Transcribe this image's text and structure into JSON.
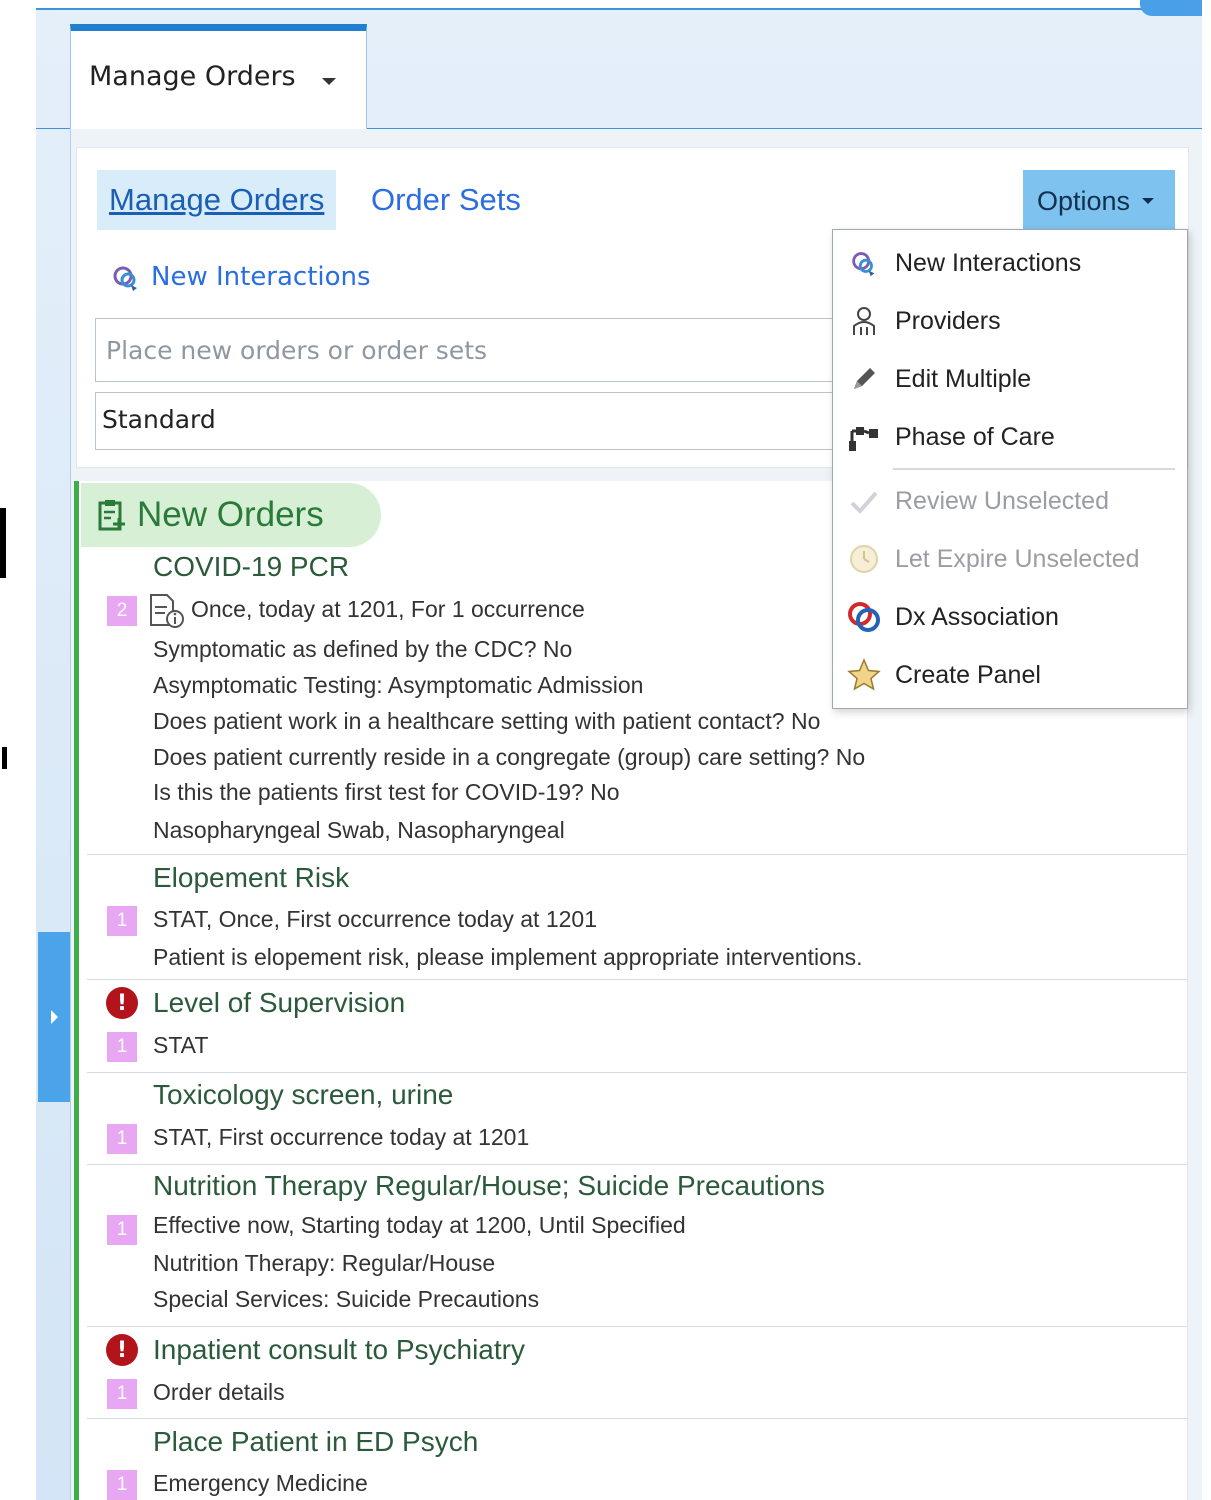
{
  "window": {
    "tab_title": "Manage Orders"
  },
  "nav": {
    "manage_orders": "Manage Orders",
    "order_sets": "Order Sets",
    "options": "Options"
  },
  "actions": {
    "new_interactions": "New Interactions"
  },
  "search": {
    "placeholder": "Place new orders or order sets",
    "value": ""
  },
  "mode": {
    "selected": "Standard"
  },
  "orders_section": {
    "title": "New Orders"
  },
  "orders": [
    {
      "name": "COVID-19 PCR",
      "badge": "2",
      "lines": [
        "Once, today at 1201, For 1 occurrence",
        "Symptomatic as defined by the CDC? No",
        "Asymptomatic Testing: Asymptomatic Admission",
        "Does patient work in a healthcare setting with patient contact? No",
        "Does patient currently reside in a congregate (group) care setting? No",
        "Is this the patients first test for COVID-19? No",
        "Nasopharyngeal Swab, Nasopharyngeal"
      ]
    },
    {
      "name": "Elopement Risk",
      "badge": "1",
      "lines": [
        "STAT,  Once, First occurrence today at 1201",
        "Patient is elopement risk, please implement appropriate interventions."
      ]
    },
    {
      "name": "Level of Supervision",
      "badge": "1",
      "alert": true,
      "lines": [
        "STAT"
      ]
    },
    {
      "name": "Toxicology screen, urine",
      "badge": "1",
      "lines": [
        "STAT, First occurrence today at 1201"
      ]
    },
    {
      "name": "Nutrition Therapy Regular/House; Suicide Precautions",
      "badge": "1",
      "lines": [
        "Effective now, Starting today at 1200, Until Specified",
        "Nutrition Therapy: Regular/House",
        "Special Services: Suicide Precautions"
      ]
    },
    {
      "name": "Inpatient consult to Psychiatry",
      "badge": "1",
      "alert": true,
      "lines": [
        "Order details"
      ]
    },
    {
      "name": "Place Patient in ED Psych",
      "badge": "1",
      "lines": [
        "Emergency Medicine"
      ]
    }
  ],
  "options_menu": {
    "items": [
      {
        "label": "New Interactions",
        "icon": "interactions-icon",
        "enabled": true
      },
      {
        "label": "Providers",
        "icon": "provider-icon",
        "enabled": true
      },
      {
        "label": "Edit Multiple",
        "icon": "pencil-icon",
        "enabled": true
      },
      {
        "label": "Phase of Care",
        "icon": "phase-of-care-icon",
        "enabled": true
      },
      {
        "label": "Review Unselected",
        "icon": "checkmark-icon",
        "enabled": false
      },
      {
        "label": "Let Expire Unselected",
        "icon": "clock-icon",
        "enabled": false
      },
      {
        "label": "Dx Association",
        "icon": "dx-link-icon",
        "enabled": true
      },
      {
        "label": "Create Panel",
        "icon": "star-icon",
        "enabled": true
      }
    ]
  },
  "colors": {
    "accent_blue": "#1f7fd1",
    "link_blue": "#2a6ee0",
    "orders_green": "#3fae49",
    "badge_purple": "#e7a7f3",
    "alert_red": "#b3141c"
  }
}
